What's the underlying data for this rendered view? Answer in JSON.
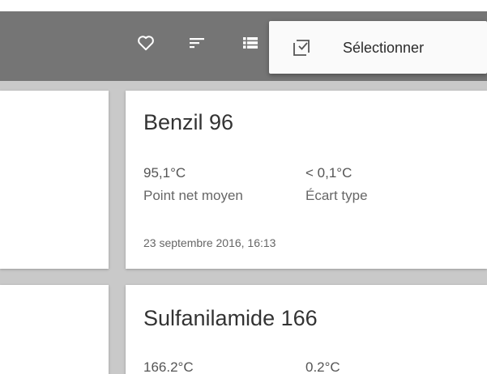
{
  "colors": {
    "appbar": "#757575",
    "background": "#c9c9c9",
    "card": "#ffffff",
    "popup": "#fafafa"
  },
  "toolbar": {
    "icons": [
      "heart-outline-icon",
      "sort-icon",
      "list-view-icon"
    ]
  },
  "overflow_menu": {
    "items": [
      {
        "icon": "select-checkbox-icon",
        "label": "Sélectionner"
      }
    ]
  },
  "cards": [
    {
      "title": "Benzil 96",
      "mean_value": "95,1°C",
      "mean_label": "Point net moyen",
      "std_value": "< 0,1°C",
      "std_label": "Écart type",
      "date": "23 septembre 2016, 16:13"
    },
    {
      "title": "Sulfanilamide 166",
      "mean_value": "166.2°C",
      "std_value": "0.2°C"
    }
  ]
}
